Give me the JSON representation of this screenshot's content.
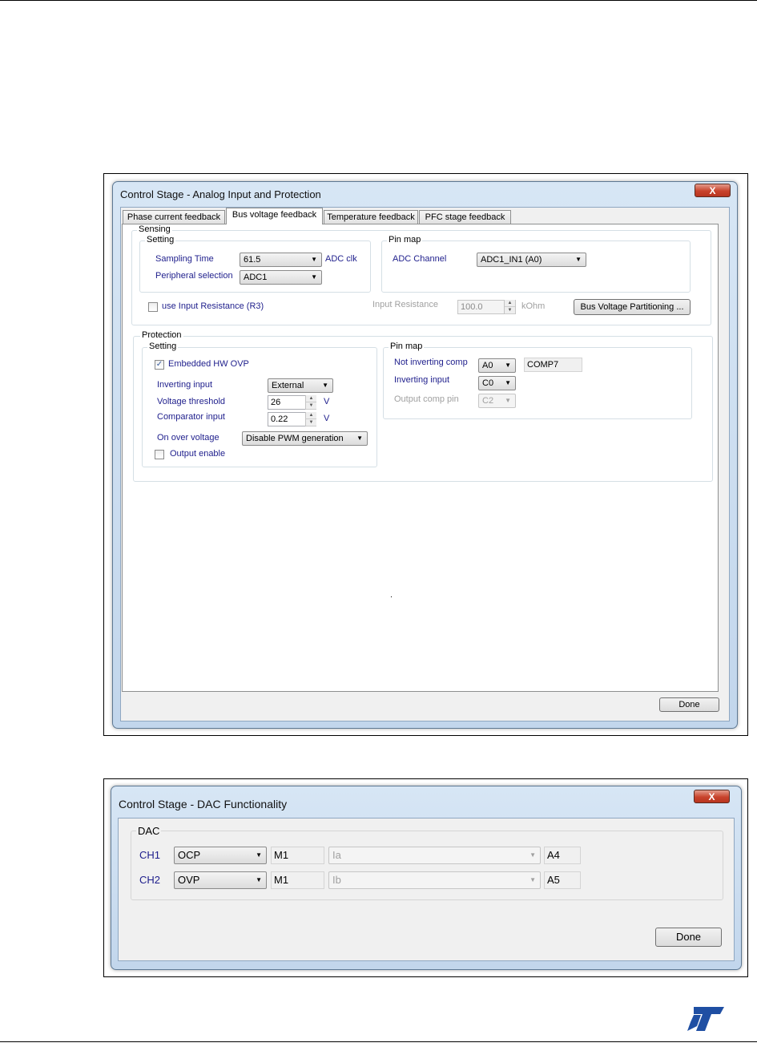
{
  "dialog1": {
    "title": "Control Stage - Analog Input and Protection",
    "close": "X",
    "tabs": [
      {
        "label": "Phase current feedback"
      },
      {
        "label": "Bus voltage feedback"
      },
      {
        "label": "Temperature feedback"
      },
      {
        "label": "PFC stage feedback"
      }
    ],
    "sensing": {
      "label": "Sensing",
      "setting": {
        "label": "Setting",
        "sampling_time_label": "Sampling Time",
        "sampling_time_value": "61.5",
        "sampling_time_unit": "ADC clk",
        "peripheral_label": "Peripheral selection",
        "peripheral_value": "ADC1"
      },
      "pinmap": {
        "label": "Pin map",
        "adc_channel_label": "ADC Channel",
        "adc_channel_value": "ADC1_IN1 (A0)"
      },
      "use_input_resistance_label": "use Input Resistance (R3)",
      "input_resistance_label": "Input Resistance",
      "input_resistance_value": "100.0",
      "input_resistance_unit": "kOhm",
      "partitioning_button": "Bus Voltage Partitioning ..."
    },
    "protection": {
      "label": "Protection",
      "setting": {
        "label": "Setting",
        "embedded_ovp_label": "Embedded HW OVP",
        "embedded_ovp_checked": true,
        "inverting_input_label": "Inverting input",
        "inverting_input_value": "External",
        "voltage_threshold_label": "Voltage threshold",
        "voltage_threshold_value": "26",
        "voltage_threshold_unit": "V",
        "comparator_input_label": "Comparator input",
        "comparator_input_value": "0.22",
        "comparator_input_unit": "V",
        "on_over_voltage_label": "On over voltage",
        "on_over_voltage_value": "Disable PWM generation",
        "output_enable_label": "Output enable",
        "output_enable_checked": false
      },
      "pinmap": {
        "label": "Pin map",
        "not_inverting_label": "Not inverting comp",
        "not_inverting_value": "A0",
        "comp_name": "COMP7",
        "inverting_label": "Inverting input",
        "inverting_value": "C0",
        "output_pin_label": "Output comp pin",
        "output_pin_value": "C2"
      }
    },
    "done": "Done"
  },
  "dialog2": {
    "title": "Control Stage - DAC Functionality",
    "close": "X",
    "group_label": "DAC",
    "rows": [
      {
        "ch": "CH1",
        "mode": "OCP",
        "motor": "M1",
        "signal": "Ia",
        "pin": "A4"
      },
      {
        "ch": "CH2",
        "mode": "OVP",
        "motor": "M1",
        "signal": "Ib",
        "pin": "A5"
      }
    ],
    "done": "Done"
  },
  "icons": {
    "checkbox_checked": "✓",
    "dropdown": "▼",
    "spin_up": "▲",
    "spin_down": "▼"
  },
  "colors": {
    "label_blue": "#1e1e8c",
    "logo_blue": "#1f4fa3"
  }
}
